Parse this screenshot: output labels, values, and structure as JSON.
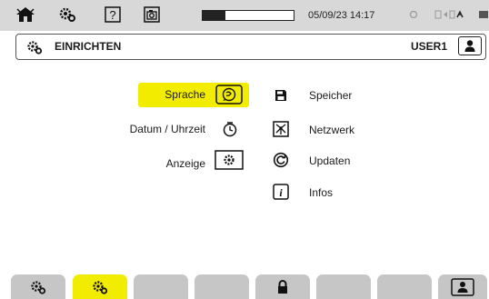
{
  "status_bar": {
    "datetime": "05/09/23 14:17",
    "battery_level": 0.25,
    "icons": [
      "home-icon",
      "settings-gears-icon",
      "help-icon",
      "camera-icon",
      "record-indicator-icon",
      "connection-icons",
      "battery-icon"
    ]
  },
  "header": {
    "title": "EINRICHTEN",
    "user": "USER1"
  },
  "menu": {
    "left": [
      {
        "label": "Sprache",
        "icon": "language-icon",
        "selected": true
      },
      {
        "label": "Datum / Uhrzeit",
        "icon": "clock-icon",
        "selected": false
      },
      {
        "label": "Anzeige",
        "icon": "display-settings-icon",
        "selected": false
      }
    ],
    "right": [
      {
        "label": "Speicher",
        "icon": "memory-icon"
      },
      {
        "label": "Netzwerk",
        "icon": "network-icon"
      },
      {
        "label": "Updaten",
        "icon": "update-icon"
      },
      {
        "label": "Infos",
        "icon": "info-icon"
      }
    ]
  },
  "tabs": [
    "settings",
    "settings-active",
    "",
    "",
    "lock",
    "",
    "",
    "user"
  ],
  "colors": {
    "highlight": "#f2ec00",
    "bar": "#d8d8d8",
    "tab": "#c6c6c6"
  }
}
